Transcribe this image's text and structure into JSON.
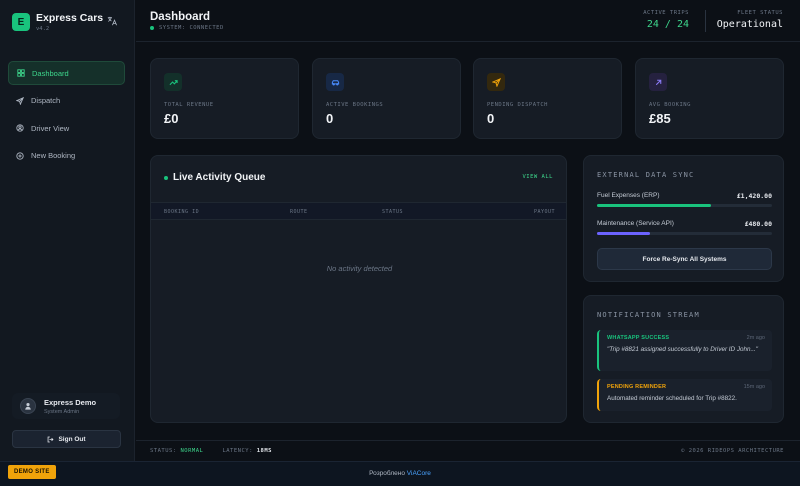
{
  "app": {
    "name": "Express Cars",
    "version": "v4.2",
    "logo_letter": "E"
  },
  "sidebar": {
    "items": [
      {
        "label": "Dashboard",
        "icon": "dashboard-icon",
        "active": true
      },
      {
        "label": "Dispatch",
        "icon": "send-icon",
        "active": false
      },
      {
        "label": "Driver View",
        "icon": "user-circle-icon",
        "active": false
      },
      {
        "label": "New Booking",
        "icon": "plus-circle-icon",
        "active": false
      }
    ],
    "user": {
      "name": "Express Demo",
      "role": "System Admin"
    },
    "signout_label": "Sign Out"
  },
  "header": {
    "title": "Dashboard",
    "system_status": "SYSTEM: CONNECTED",
    "active_trips_label": "ACTIVE TRIPS",
    "active_trips_value": "24 / 24",
    "fleet_status_label": "FLEET STATUS",
    "fleet_status_value": "Operational"
  },
  "stats": [
    {
      "label": "TOTAL REVENUE",
      "value": "£0",
      "icon": "trending-up-icon",
      "color": "#19c37d"
    },
    {
      "label": "ACTIVE BOOKINGS",
      "value": "0",
      "icon": "car-icon",
      "color": "#4a8dff"
    },
    {
      "label": "PENDING DISPATCH",
      "value": "0",
      "icon": "send-icon",
      "color": "#f0a30a"
    },
    {
      "label": "AVG BOOKING",
      "value": "£85",
      "icon": "arrow-up-right-icon",
      "color": "#8b7cf6"
    }
  ],
  "activity": {
    "title": "Live Activity Queue",
    "view_all": "VIEW ALL",
    "columns": [
      "BOOKING ID",
      "ROUTE",
      "STATUS",
      "PAYOUT"
    ],
    "empty_text": "No activity detected"
  },
  "sync": {
    "title": "EXTERNAL DATA SYNC",
    "rows": [
      {
        "label": "Fuel Expenses (ERP)",
        "value": "£1,420.00",
        "progress": 0.65,
        "color": "#19c37d"
      },
      {
        "label": "Maintenance (Service API)",
        "value": "£480.00",
        "progress": 0.3,
        "color": "#6c63ff"
      }
    ],
    "button_label": "Force Re-Sync All Systems"
  },
  "notifications": {
    "title": "NOTIFICATION STREAM",
    "items": [
      {
        "tag": "WHATSAPP SUCCESS",
        "time": "2m ago",
        "message": "\"Trip #8821 assigned successfully to Driver ID John...\"",
        "color": "#19c37d"
      },
      {
        "tag": "PENDING REMINDER",
        "time": "15m ago",
        "message": "Automated reminder scheduled for Trip #8822.",
        "color": "#f0a30a"
      }
    ]
  },
  "statusbar": {
    "status_label": "STATUS:",
    "status_value": "NORMAL",
    "latency_label": "LATENCY:",
    "latency_value": "18MS",
    "copyright": "© 2026 RIDEOPS ARCHITECTURE"
  },
  "bottombar": {
    "demo_label": "DEMO SITE",
    "credit_prefix": "Розроблено",
    "credit_link": "ViACore"
  }
}
